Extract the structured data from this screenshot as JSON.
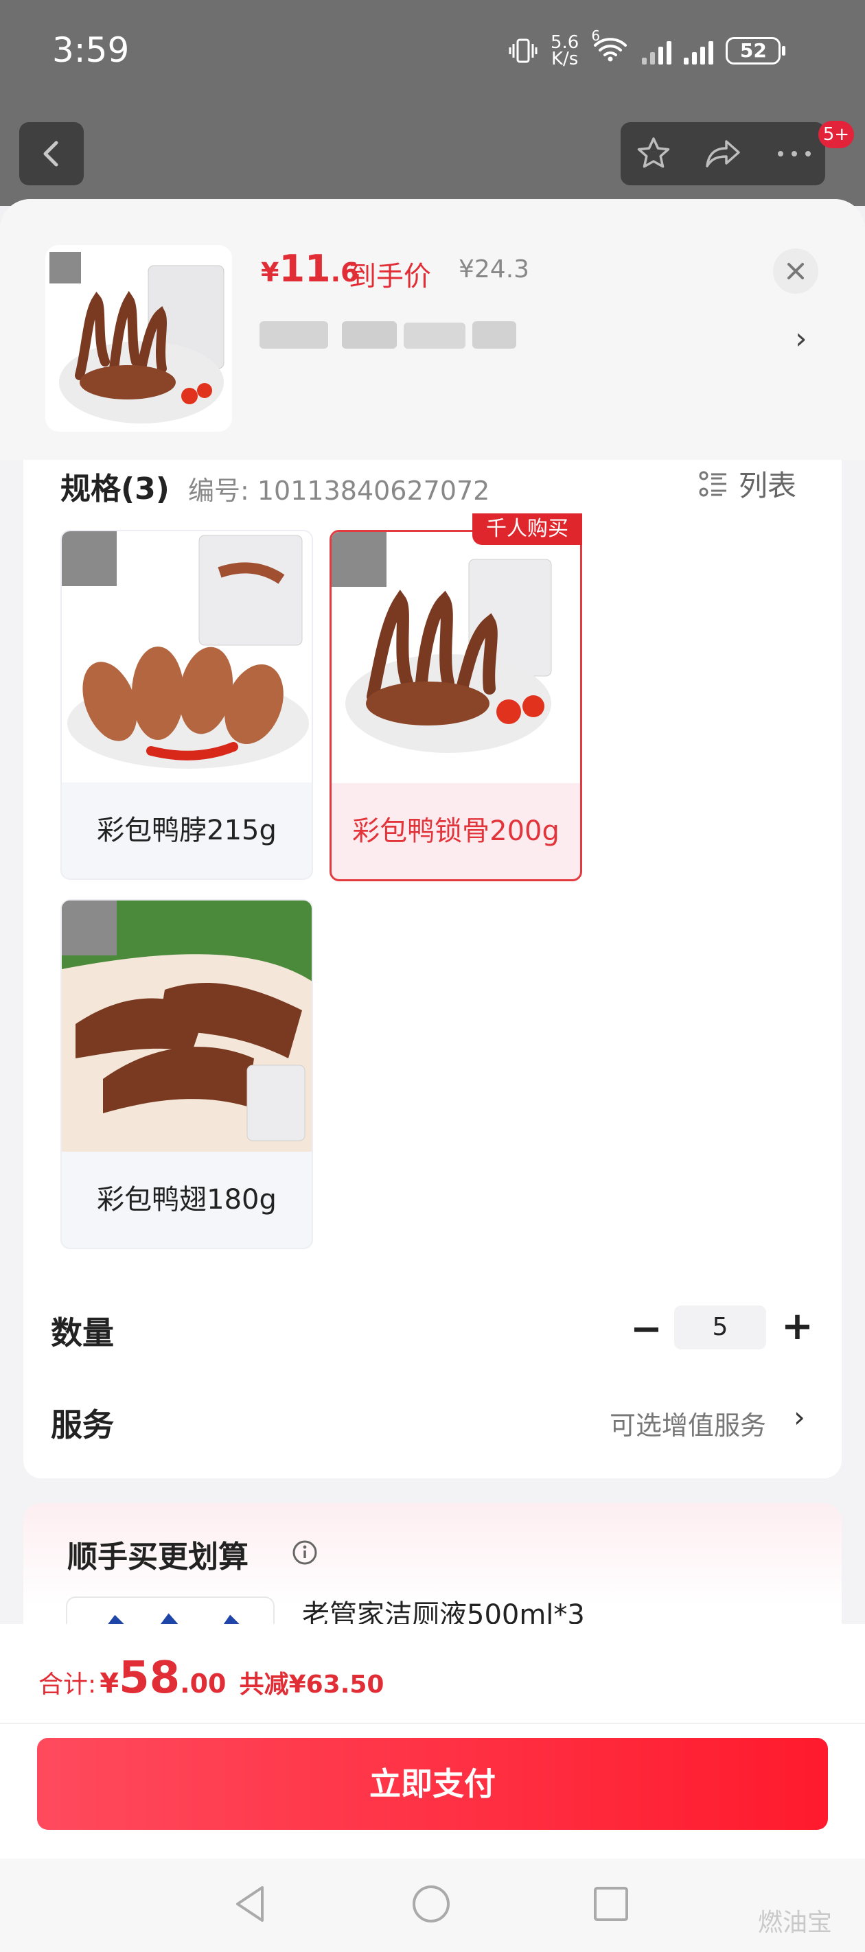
{
  "status_bar": {
    "time": "3:59",
    "net_speed_top": "5.6",
    "net_speed_unit": "K/s",
    "wifi_badge": "6",
    "battery": "52"
  },
  "top_nav": {
    "badge": "5+"
  },
  "product": {
    "price_currency": "¥",
    "price_int": "11",
    "price_dec": ".6",
    "price_label": "到手价",
    "original_price": "¥24.3"
  },
  "spec": {
    "title": "规格(3)",
    "code": "编号: 10113840627072",
    "list_toggle": "列表",
    "hot_tag": "千人购买",
    "skus": [
      {
        "label": "彩包鸭脖215g",
        "selected": false
      },
      {
        "label": "彩包鸭锁骨200g",
        "selected": true
      },
      {
        "label": "彩包鸭翅180g",
        "selected": false
      }
    ]
  },
  "quantity": {
    "label": "数量",
    "value": "5"
  },
  "service": {
    "label": "服务",
    "value": "可选增值服务"
  },
  "upsell": {
    "title": "顺手买更划算",
    "item_name": "老管家洁厕液500ml*3"
  },
  "summary": {
    "label": "合计:",
    "currency": "¥",
    "int": "58",
    "dec": ".00",
    "savings": "共减¥63.50"
  },
  "pay_button": "立即支付",
  "watermark": "燃油宝",
  "colors": {
    "accent": "#e12d35",
    "pay_start": "#ff4a5d",
    "pay_end": "#ff1a2d"
  }
}
